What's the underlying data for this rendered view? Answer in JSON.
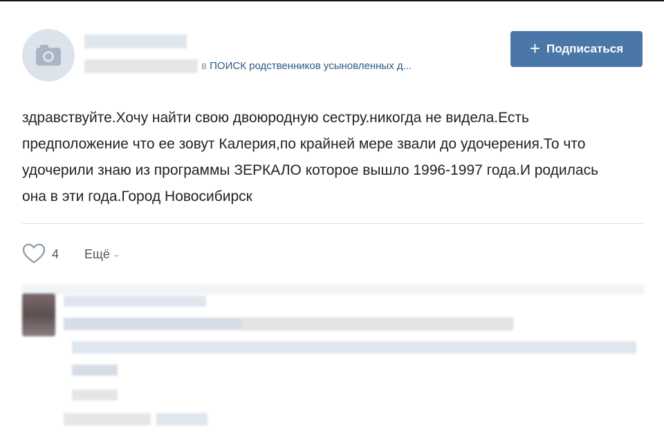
{
  "post": {
    "group_prefix": "в",
    "group_name": "ПОИСК родственников усыновленных д...",
    "text_lines": [
      "здравствуйте.Хочу найти свою двоюродную сестру.никогда не видела.Есть",
      "предположение что ее зовут Калерия,по крайней мере звали до удочерения.То что",
      "удочерили знаю из программы ЗЕРКАЛО которое вышло 1996-1997 года.И родилась",
      "она в эти года.Город Новосибирск"
    ]
  },
  "subscribe": {
    "plus": "+",
    "label": "Подписаться"
  },
  "actions": {
    "like_count": "4",
    "more_label": "Ещё",
    "more_chevron": "⌄"
  },
  "icons": {
    "avatar": "camera-icon",
    "like": "heart-icon",
    "more": "chevron-down-icon"
  },
  "colors": {
    "accent": "#4a76a8",
    "link": "#2a5885",
    "avatar_bg": "#dde3eb"
  }
}
